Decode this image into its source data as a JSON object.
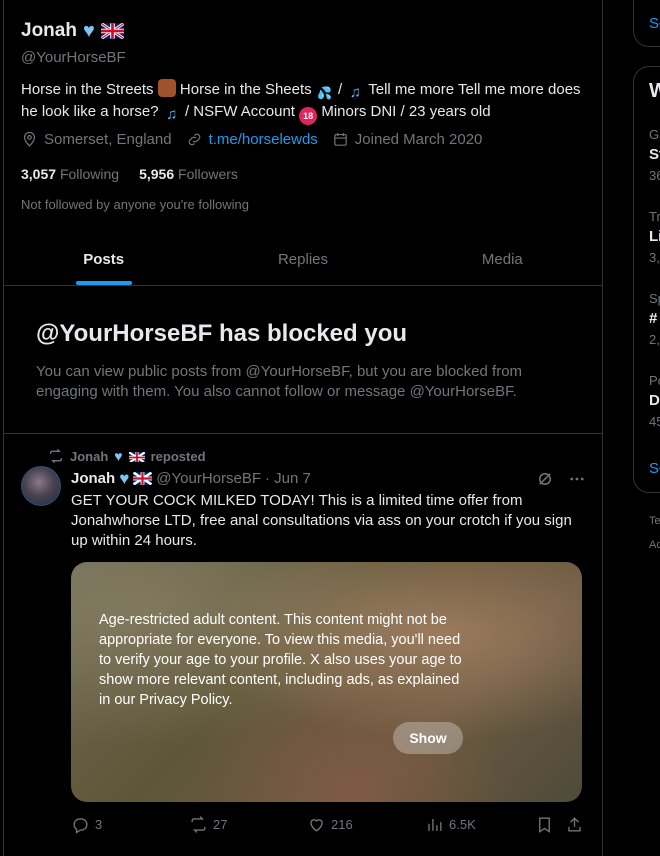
{
  "profile": {
    "name": "Jonah",
    "handle": "@YourHorseBF",
    "bio_parts": {
      "p1": "Horse in the Streets",
      "p2": "Horse in the Sheets",
      "p3": "/",
      "p4": "Tell me more Tell me more does he look like a horse?",
      "p5": "/ NSFW Account",
      "p6": "Minors DNI / 23 years old"
    },
    "location": "Somerset, England",
    "link": "t.me/horselewds",
    "joined": "Joined March 2020",
    "following_count": "3,057",
    "following_label": "Following",
    "followers_count": "5,956",
    "followers_label": "Followers",
    "not_followed": "Not followed by anyone you're following"
  },
  "tabs": [
    {
      "label": "Posts",
      "active": true
    },
    {
      "label": "Replies",
      "active": false
    },
    {
      "label": "Media",
      "active": false
    }
  ],
  "blocked": {
    "title": "@YourHorseBF has blocked you",
    "text": "You can view public posts from @YourHorseBF, but you are blocked from engaging with them. You also cannot follow or message @YourHorseBF."
  },
  "post": {
    "repost_name": "Jonah",
    "repost_label": "reposted",
    "author_name": "Jonah",
    "author_handle": "@YourHorseBF",
    "date": "· Jun 7",
    "text": "GET YOUR COCK MILKED TODAY! This is a limited time offer from Jonahwhorse LTD, free anal consultations via ass on your crotch if you sign up within 24 hours.",
    "media_warning": "Age-restricted adult content. This content might not be appropriate for everyone. To view this media, you'll need to verify your age to your profile. X also uses your age to show more relevant content, including ads, as explained in our Privacy Policy.",
    "show_label": "Show",
    "replies": "3",
    "reposts": "27",
    "likes": "216",
    "views": "6.5K"
  },
  "right_column": {
    "top_link": "Sł",
    "card_title": "W",
    "items": [
      {
        "cat": "Ga",
        "title": "St",
        "count": "36"
      },
      {
        "cat": "Tr",
        "title": "Li",
        "count": "3,"
      },
      {
        "cat": "Sp",
        "title": "#",
        "count": "2,"
      },
      {
        "cat": "Po",
        "title": "D",
        "count": "45"
      }
    ],
    "show_more": "Sł",
    "footer1": "Te",
    "footer2": "Ac"
  },
  "colors": {
    "accent": "#1d9bf0",
    "muted": "#71767b",
    "text": "#e7e9ea",
    "border": "#2f3336"
  }
}
